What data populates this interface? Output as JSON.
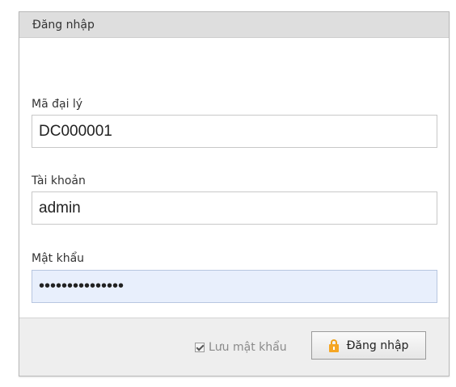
{
  "panel": {
    "title": "Đăng nhập"
  },
  "fields": {
    "agent_code": {
      "label": "Mã đại lý",
      "value": "DC000001"
    },
    "account": {
      "label": "Tài khoản",
      "value": "admin"
    },
    "password": {
      "label": "Mật khẩu",
      "value": "•••••••••••••••"
    }
  },
  "footer": {
    "remember_label": "Lưu mật khẩu",
    "remember_checked": true,
    "login_label": "Đăng nhập",
    "login_icon": "lock-icon"
  },
  "colors": {
    "focused_input_bg": "#e8effc",
    "lock_icon": "#f5a623",
    "header_bg": "#dedede",
    "footer_bg": "#eeeeee"
  }
}
